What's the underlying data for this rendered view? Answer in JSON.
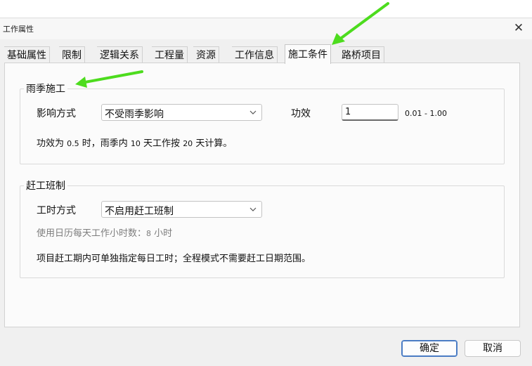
{
  "window": {
    "title": "工作属性",
    "close_glyph": "✕"
  },
  "tabs": [
    {
      "label": "基础属性"
    },
    {
      "label": "限制"
    },
    {
      "label": "逻辑关系"
    },
    {
      "label": "工程量"
    },
    {
      "label": "资源"
    },
    {
      "label": "工作信息"
    },
    {
      "label": "施工条件",
      "active": true
    },
    {
      "label": "路桥项目"
    }
  ],
  "rain": {
    "title": "雨季施工",
    "mode_label": "影响方式",
    "mode_value": "不受雨季影响",
    "eff_label": "功效",
    "eff_value": "1",
    "eff_range": "0.01 - 1.00",
    "desc_a": "功效为",
    "desc_val1": "0.5",
    "desc_b": " 时，雨季内 ",
    "desc_val2": "10",
    "desc_c": " 天工作按 ",
    "desc_val3": "20",
    "desc_d": " 天计算。"
  },
  "rush": {
    "title": "赶工班制",
    "mode_label": "工时方式",
    "mode_value": "不启用赶工班制",
    "hours_text": "使用日历每天工作小时数：",
    "hours_value": "8",
    "hours_unit": " 小时",
    "note": "项目赶工期内可单独指定每日工时；全程模式不需要赶工日期范围。"
  },
  "buttons": {
    "ok": "确定",
    "cancel": "取消"
  },
  "colors": {
    "annotation_arrow": "#4ddc1e",
    "accent": "#4a7cc4"
  }
}
